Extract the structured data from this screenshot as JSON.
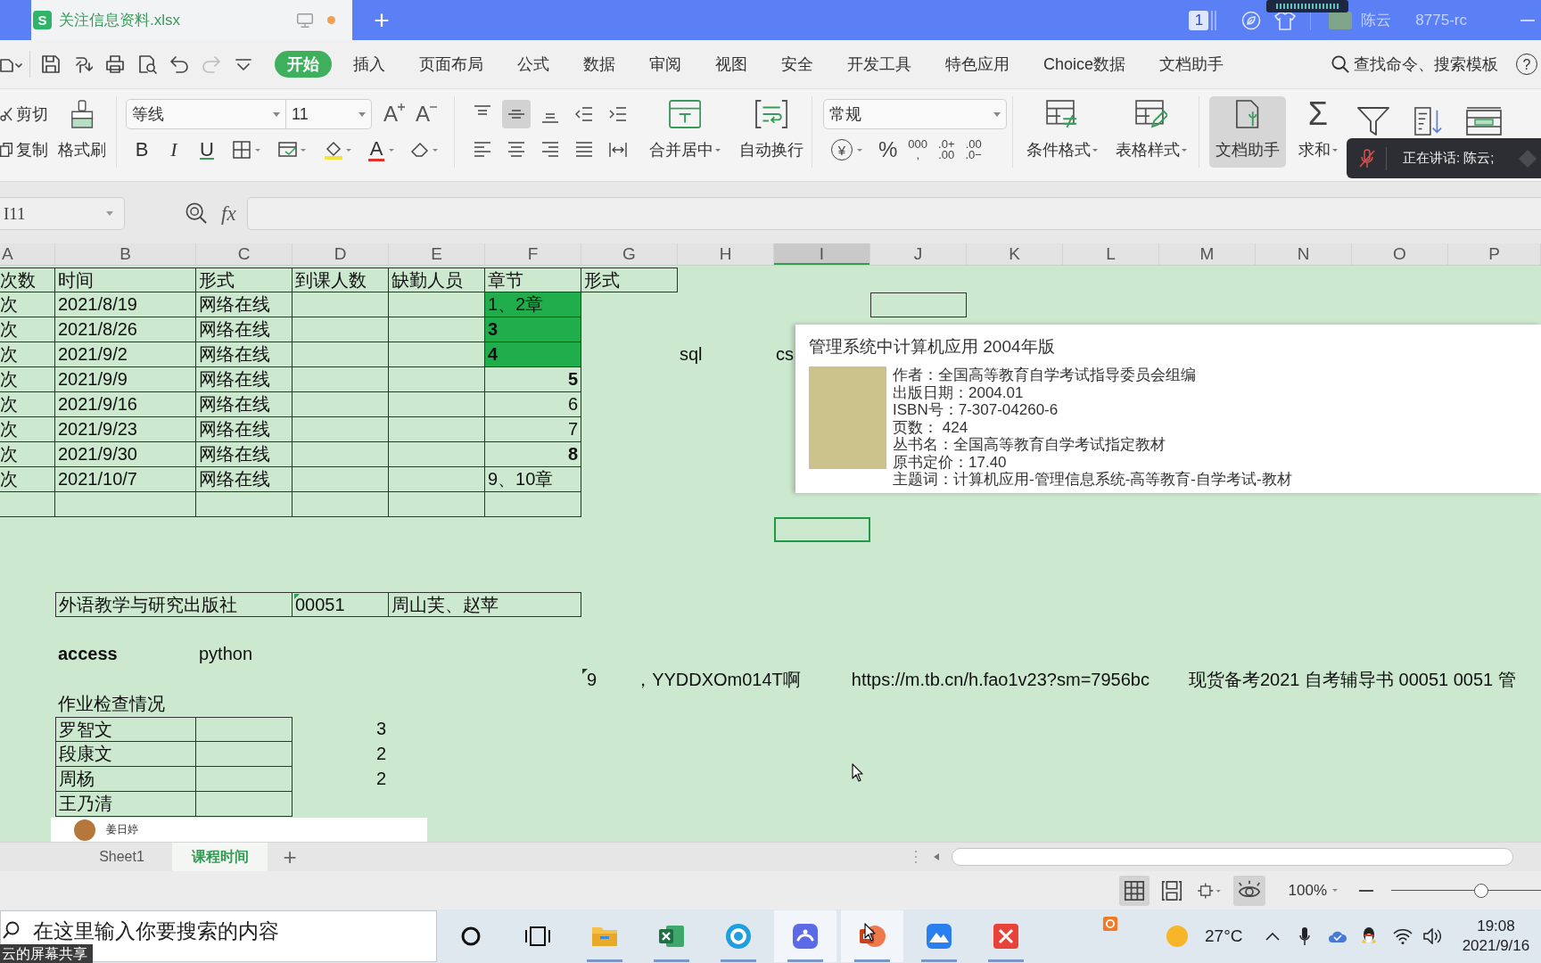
{
  "title_bar": {
    "logo_letter": "S",
    "document_tab": {
      "title": "关注信息资料.xlsx",
      "unsaved": true
    },
    "new_tab": "+",
    "badge": "1",
    "user_name": "陈云",
    "user_id": "8775-rc"
  },
  "quick_access": [
    {
      "kind": "file_menu",
      "disabled": false
    },
    {
      "kind": "save",
      "disabled": false
    },
    {
      "kind": "export",
      "disabled": false
    },
    {
      "kind": "print",
      "disabled": false
    },
    {
      "kind": "preview",
      "disabled": false
    },
    {
      "kind": "undo",
      "disabled": false
    },
    {
      "kind": "redo",
      "disabled": true
    },
    {
      "kind": "customize",
      "disabled": false
    }
  ],
  "menu_tabs": [
    {
      "label": "开始",
      "selected": true
    },
    {
      "label": "插入",
      "selected": false
    },
    {
      "label": "页面布局",
      "selected": false
    },
    {
      "label": "公式",
      "selected": false
    },
    {
      "label": "数据",
      "selected": false
    },
    {
      "label": "审阅",
      "selected": false
    },
    {
      "label": "视图",
      "selected": false
    },
    {
      "label": "安全",
      "selected": false
    },
    {
      "label": "开发工具",
      "selected": false
    },
    {
      "label": "特色应用",
      "selected": false
    },
    {
      "label": "Choice数据",
      "selected": false
    },
    {
      "label": "文档助手",
      "selected": false
    }
  ],
  "command_search": "查找命令、搜索模板",
  "help": "?",
  "ribbon": {
    "clipboard": {
      "cut": "剪切",
      "copy": "复制",
      "format_painter": "格式刷"
    },
    "font": {
      "family": "等线",
      "size": "11",
      "grow": "A",
      "shrink": "A",
      "bold": "B",
      "italic": "I",
      "underline": "U",
      "font_color": "A"
    },
    "align_buttons": [
      {
        "kind": "top",
        "selected": false
      },
      {
        "kind": "middle",
        "selected": true
      },
      {
        "kind": "bottom",
        "selected": false
      },
      {
        "kind": "outdent",
        "selected": false
      },
      {
        "kind": "indent",
        "selected": false
      },
      {
        "kind": "left",
        "selected": false
      },
      {
        "kind": "center",
        "selected": false
      },
      {
        "kind": "right",
        "selected": false
      },
      {
        "kind": "justify",
        "selected": false
      },
      {
        "kind": "distributed",
        "selected": false
      }
    ],
    "merge": "合并居中",
    "wrap": "自动换行",
    "number_format": "常规",
    "number_buttons": [
      {
        "kind": "currency",
        "lines": [
          "¥"
        ]
      },
      {
        "kind": "percent",
        "lines": [
          "%"
        ]
      },
      {
        "kind": "thousands",
        "lines": [
          "000",
          ","
        ]
      },
      {
        "kind": "add_decimal",
        "lines": [
          ".0+",
          ".00"
        ]
      },
      {
        "kind": "remove_decimal",
        "lines": [
          ".00",
          ".0−"
        ]
      }
    ],
    "styles": [
      {
        "kind": "conditional",
        "label": "条件格式"
      },
      {
        "kind": "table",
        "label": "表格样式"
      }
    ],
    "doc_assistant": {
      "label": "文档助手",
      "selected": true
    },
    "sum": {
      "glyph": "Σ",
      "label": "求和"
    }
  },
  "speaking_toast": {
    "text": "正在讲话: 陈云;"
  },
  "formula_bar": {
    "name_box": "I11",
    "fx": "fx"
  },
  "sheet": {
    "columns": [
      {
        "label": "A",
        "selected": false
      },
      {
        "label": "B",
        "selected": false
      },
      {
        "label": "C",
        "selected": false
      },
      {
        "label": "D",
        "selected": false
      },
      {
        "label": "E",
        "selected": false
      },
      {
        "label": "F",
        "selected": false
      },
      {
        "label": "G",
        "selected": false
      },
      {
        "label": "H",
        "selected": false
      },
      {
        "label": "I",
        "selected": true
      },
      {
        "label": "J",
        "selected": false
      },
      {
        "label": "K",
        "selected": false
      },
      {
        "label": "L",
        "selected": false
      },
      {
        "label": "M",
        "selected": false
      },
      {
        "label": "N",
        "selected": false
      },
      {
        "label": "O",
        "selected": false
      },
      {
        "label": "P",
        "selected": false
      }
    ],
    "main_table": {
      "headers": [
        "次数",
        "时间",
        "形式",
        "到课人数",
        "缺勤人员",
        "章节",
        "形式"
      ],
      "rows": [
        {
          "session": "次",
          "date": "2021/8/19",
          "mode": "网络在线",
          "chapter": {
            "text": "1、2章",
            "kind": "text",
            "highlighted": true,
            "bold": false
          }
        },
        {
          "session": "次",
          "date": "2021/8/26",
          "mode": "网络在线",
          "chapter": {
            "text": "3",
            "kind": "text",
            "highlighted": true,
            "bold": true
          }
        },
        {
          "session": "次",
          "date": "2021/9/2",
          "mode": "网络在线",
          "chapter": {
            "text": "4",
            "kind": "text",
            "highlighted": true,
            "bold": true
          }
        },
        {
          "session": "次",
          "date": "2021/9/9",
          "mode": "网络在线",
          "chapter": {
            "text": "5",
            "kind": "number",
            "highlighted": false,
            "bold": true
          }
        },
        {
          "session": "次",
          "date": "2021/9/16",
          "mode": "网络在线",
          "chapter": {
            "text": "6",
            "kind": "number",
            "highlighted": false,
            "bold": false
          }
        },
        {
          "session": "次",
          "date": "2021/9/23",
          "mode": "网络在线",
          "chapter": {
            "text": "7",
            "kind": "number",
            "highlighted": false,
            "bold": false
          }
        },
        {
          "session": "次",
          "date": "2021/9/30",
          "mode": "网络在线",
          "chapter": {
            "text": "8",
            "kind": "number",
            "highlighted": false,
            "bold": true
          }
        },
        {
          "session": "次",
          "date": "2021/10/7",
          "mode": "网络在线",
          "chapter": {
            "text": "9、10章",
            "kind": "text",
            "highlighted": false,
            "bold": false
          }
        }
      ]
    },
    "side_notes": [
      "sql",
      "cs"
    ],
    "publisher_row": {
      "publisher": "外语教学与研究出版社",
      "course_code": "00051",
      "authors": "周山芙、赵苹"
    },
    "languages": [
      {
        "text": "access",
        "bold": true
      },
      {
        "text": "python",
        "bold": false
      }
    ],
    "share_text": [
      "9",
      "，",
      "YYDDXOm014T啊",
      "https://m.tb.cn/h.fao1v23?sm=7956bc",
      "现货备考2021 自考辅导书 00051 0051 管"
    ],
    "homework": {
      "title": "作业检查情况",
      "rows": [
        {
          "name": "罗智文",
          "count": "3"
        },
        {
          "name": "段康文",
          "count": "2"
        },
        {
          "name": "周杨",
          "count": "2"
        },
        {
          "name": "王乃清"
        }
      ]
    }
  },
  "book_popup": {
    "title": "管理系统中计算机应用 2004年版",
    "lines": [
      "作者：全国高等教育自学考试指导委员会组编",
      "出版日期：2004.01",
      "ISBN号：7-307-04260-6",
      "页数： 424",
      "丛书名：全国高等教育自学考试指定教材",
      "原书定价：17.40",
      "主题词：计算机应用-管理信息系统-高等教育-自学考试-教材"
    ]
  },
  "participant": {
    "name": "姜日婷"
  },
  "sheet_tabs": {
    "tabs": [
      {
        "label": "Sheet1",
        "selected": false
      },
      {
        "label": "课程时间",
        "selected": true
      }
    ],
    "add": "+"
  },
  "status_bar": {
    "views": [
      {
        "kind": "normal",
        "selected": true
      },
      {
        "kind": "page_break",
        "selected": false
      },
      {
        "kind": "page_layout",
        "selected": false
      }
    ],
    "eye_protection": true,
    "zoom": "100%",
    "zoom_slider": {
      "level": 0.6
    }
  },
  "taskbar": {
    "search": {
      "placeholder": "在这里输入你要搜索的内容"
    },
    "apps": [
      {
        "kind": "cortana",
        "running": false,
        "highlighted": false
      },
      {
        "kind": "task_view",
        "running": false,
        "highlighted": false
      },
      {
        "kind": "explorer",
        "running": true,
        "highlighted": false
      },
      {
        "kind": "excel",
        "running": true,
        "highlighted": false
      },
      {
        "kind": "browser",
        "running": true,
        "highlighted": false
      },
      {
        "kind": "wps",
        "running": true,
        "highlighted": true
      },
      {
        "kind": "presentation",
        "running": true,
        "highlighted": true
      },
      {
        "kind": "lark",
        "running": true,
        "highlighted": false
      },
      {
        "kind": "red_app",
        "running": true,
        "highlighted": false
      }
    ],
    "temperature": "27°C",
    "time": "19:08",
    "date": "2021/9/16"
  },
  "share_label": "云的屏幕共享"
}
